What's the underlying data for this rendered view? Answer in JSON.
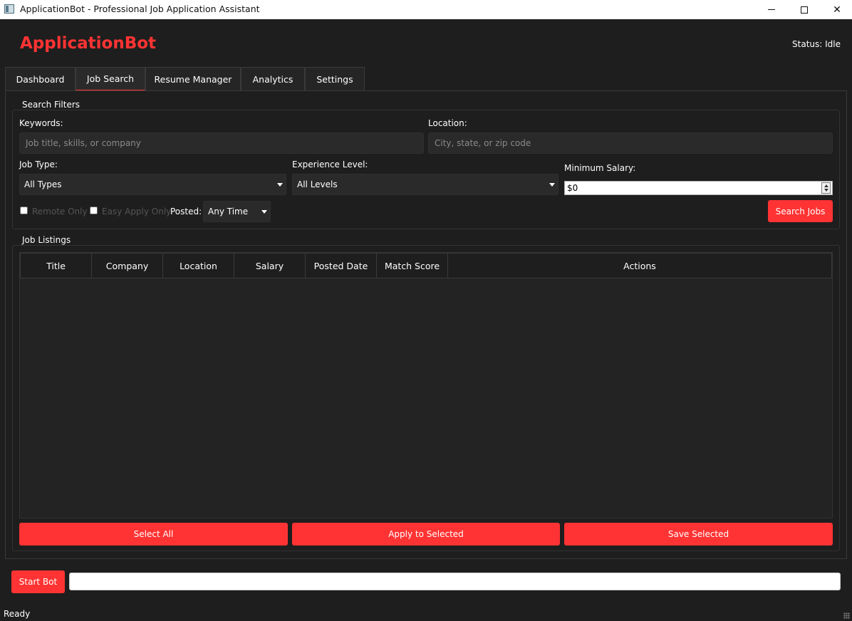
{
  "window": {
    "title": "ApplicationBot - Professional Job Application Assistant",
    "icons": [
      "app-icon",
      "minimize-icon",
      "maximize-icon",
      "close-icon"
    ]
  },
  "header": {
    "brand": "ApplicationBot",
    "status": "Status: Idle",
    "accent_color": "#ff3333"
  },
  "tabs": [
    {
      "label": "Dashboard",
      "active": false
    },
    {
      "label": "Job Search",
      "active": true
    },
    {
      "label": "Resume Manager",
      "active": false
    },
    {
      "label": "Analytics",
      "active": false
    },
    {
      "label": "Settings",
      "active": false
    }
  ],
  "filters": {
    "group_title": "Search Filters",
    "keywords_label": "Keywords:",
    "keywords_placeholder": "Job title, skills, or company",
    "keywords_value": "",
    "location_label": "Location:",
    "location_placeholder": "City, state, or zip code",
    "location_value": "",
    "job_type_label": "Job Type:",
    "job_type_value": "All Types",
    "experience_label": "Experience Level:",
    "experience_value": "All Levels",
    "salary_label": "Minimum Salary:",
    "salary_value": "$0",
    "remote_only_label": "Remote Only",
    "remote_only_checked": false,
    "easy_apply_label": "Easy Apply Only",
    "easy_apply_checked": false,
    "posted_label": "Posted:",
    "posted_value": "Any Time",
    "search_button": "Search Jobs"
  },
  "listings": {
    "group_title": "Job Listings",
    "columns": [
      "Title",
      "Company",
      "Location",
      "Salary",
      "Posted Date",
      "Match Score",
      "Actions"
    ],
    "rows": [],
    "select_all_button": "Select All",
    "apply_button": "Apply to Selected",
    "save_button": "Save Selected"
  },
  "footer": {
    "start_button": "Start Bot",
    "progress": 0,
    "status_text": "Ready"
  }
}
